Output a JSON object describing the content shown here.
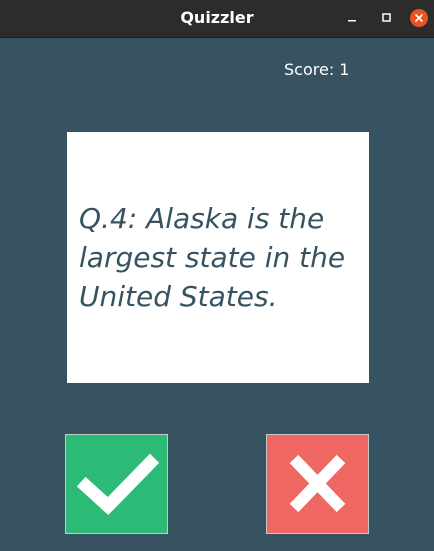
{
  "window": {
    "title": "Quizzler",
    "controls": [
      "minimize-icon",
      "maximize-icon",
      "close-icon"
    ],
    "close_color": "#e95420"
  },
  "score": {
    "label": "Score: 1"
  },
  "question": {
    "text": "Q.4: Alaska is the largest state in the United States."
  },
  "buttons": {
    "true": {
      "icon": "check-icon",
      "color": "#2bbb76"
    },
    "false": {
      "icon": "cross-icon",
      "color": "#ee6762"
    }
  },
  "colors": {
    "background": "#375362",
    "card": "#ffffff",
    "question_text": "#375362"
  }
}
